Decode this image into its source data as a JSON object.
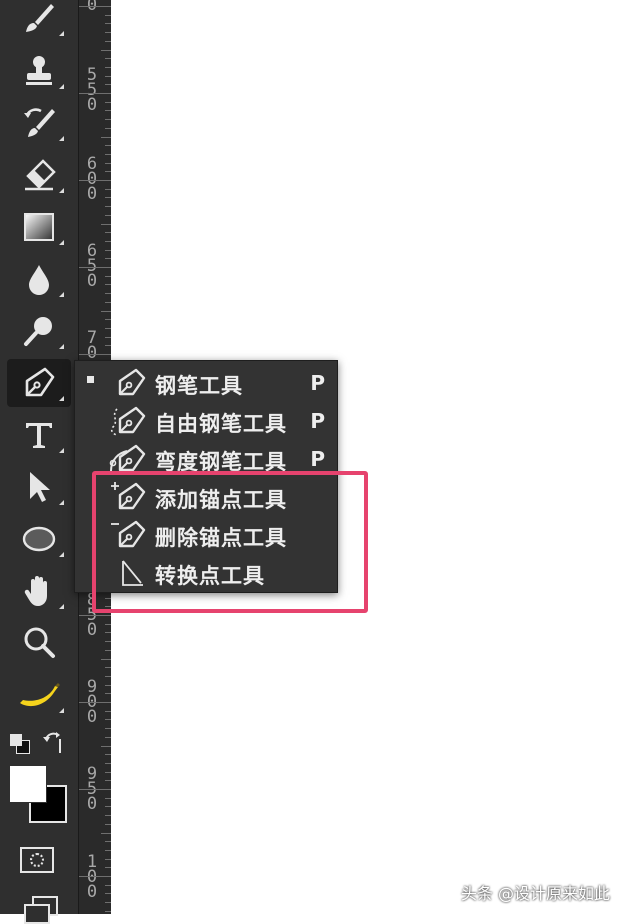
{
  "toolbar": {
    "tools": [
      {
        "name": "brush-tool",
        "icon": "brush-icon"
      },
      {
        "name": "clone-stamp-tool",
        "icon": "stamp-icon"
      },
      {
        "name": "history-brush-tool",
        "icon": "history-brush-icon"
      },
      {
        "name": "eraser-tool",
        "icon": "eraser-icon"
      },
      {
        "name": "gradient-tool",
        "icon": "gradient-icon"
      },
      {
        "name": "blur-tool",
        "icon": "drop-icon"
      },
      {
        "name": "dodge-tool",
        "icon": "dodge-icon"
      },
      {
        "name": "pen-tool",
        "icon": "pen-icon",
        "active": true
      },
      {
        "name": "type-tool",
        "icon": "type-icon",
        "glyph": "T"
      },
      {
        "name": "path-selection-tool",
        "icon": "arrow-icon"
      },
      {
        "name": "ellipse-tool",
        "icon": "ellipse-icon"
      },
      {
        "name": "hand-tool",
        "icon": "hand-icon"
      },
      {
        "name": "zoom-tool",
        "icon": "zoom-icon"
      },
      {
        "name": "banana-tool",
        "icon": "banana-icon"
      }
    ],
    "colors": {
      "foreground": "#ffffff",
      "background": "#000000"
    }
  },
  "ruler": {
    "labels": [
      "0",
      "550",
      "600",
      "650",
      "70",
      "850",
      "900",
      "950",
      "100"
    ]
  },
  "flyout": {
    "items": [
      {
        "label": "钢笔工具",
        "shortcut": "P",
        "icon": "pen-icon",
        "selected": true
      },
      {
        "label": "自由钢笔工具",
        "shortcut": "P",
        "icon": "freeform-pen-icon"
      },
      {
        "label": "弯度钢笔工具",
        "shortcut": "P",
        "icon": "curvature-pen-icon"
      },
      {
        "label": "添加锚点工具",
        "shortcut": "",
        "icon": "add-anchor-icon"
      },
      {
        "label": "删除锚点工具",
        "shortcut": "",
        "icon": "delete-anchor-icon"
      },
      {
        "label": "转换点工具",
        "shortcut": "",
        "icon": "convert-point-icon"
      }
    ]
  },
  "highlight_color": "#e6436e",
  "watermark": "头条 @设计原来如此"
}
